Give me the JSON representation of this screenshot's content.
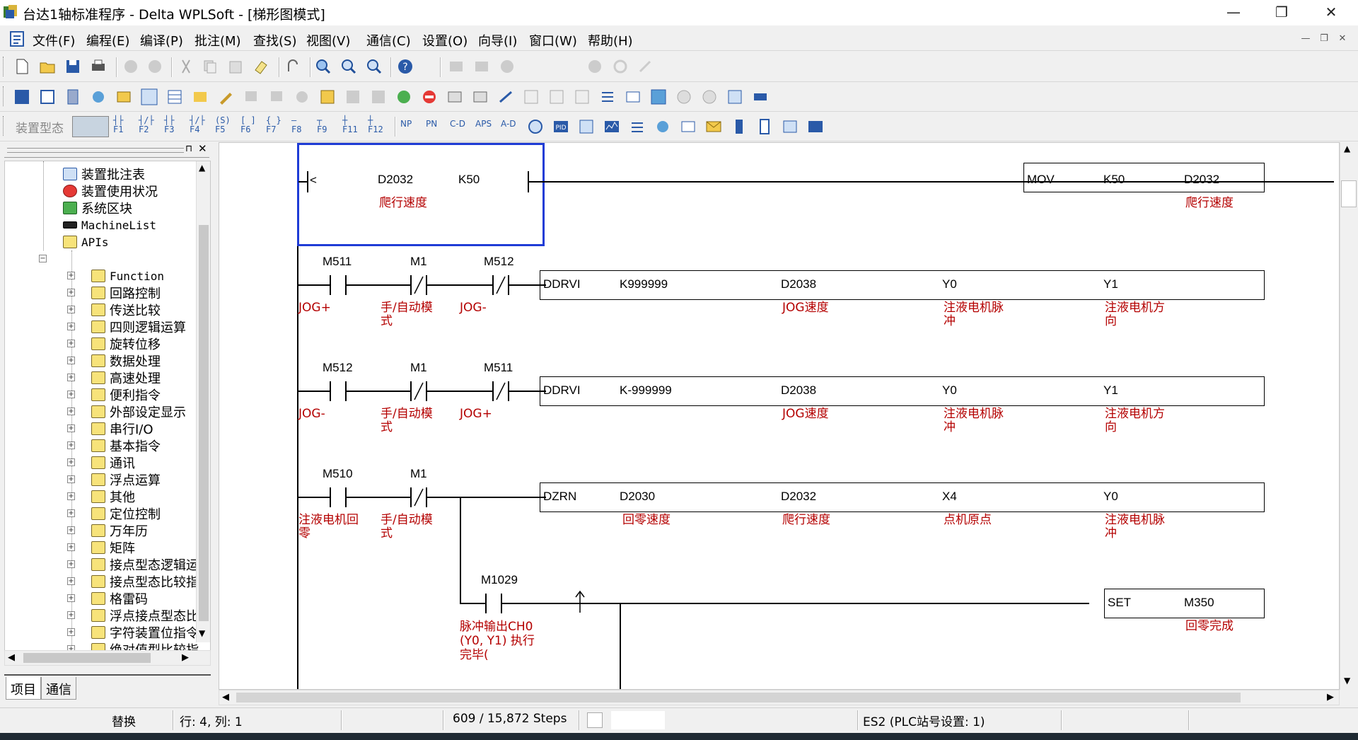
{
  "window": {
    "title": "台达1轴标准程序 - Delta WPLSoft - [梯形图模式]",
    "minimize": "—",
    "restore": "❐",
    "close": "✕"
  },
  "menu": [
    {
      "label": "文件(F)"
    },
    {
      "label": "编程(E)"
    },
    {
      "label": "编译(P)"
    },
    {
      "label": "批注(M)"
    },
    {
      "label": "查找(S)"
    },
    {
      "label": "视图(V)"
    },
    {
      "label": "通信(C)"
    },
    {
      "label": "设置(O)"
    },
    {
      "label": "向导(I)"
    },
    {
      "label": "窗口(W)"
    },
    {
      "label": "帮助(H)"
    }
  ],
  "toolbar1": {
    "step_value": "1"
  },
  "toolbar3": {
    "device_type_label": "装置型态",
    "fkeys": [
      "F1",
      "F2",
      "F3",
      "F4",
      "F5",
      "F6",
      "F7",
      "F8",
      "F9",
      "F11",
      "F12"
    ]
  },
  "project_tree": {
    "items": [
      {
        "label": "装置批注表",
        "indent": 1
      },
      {
        "label": "装置使用状况",
        "indent": 1
      },
      {
        "label": "系统区块",
        "indent": 1
      },
      {
        "label": "MachineList",
        "indent": 1
      },
      {
        "label": "APIs",
        "indent": 0,
        "expanded": true
      },
      {
        "label": "Function",
        "indent": 2
      },
      {
        "label": "回路控制",
        "indent": 2
      },
      {
        "label": "传送比较",
        "indent": 2
      },
      {
        "label": "四则逻辑运算",
        "indent": 2
      },
      {
        "label": "旋转位移",
        "indent": 2
      },
      {
        "label": "数据处理",
        "indent": 2
      },
      {
        "label": "高速处理",
        "indent": 2
      },
      {
        "label": "便利指令",
        "indent": 2
      },
      {
        "label": "外部设定显示",
        "indent": 2
      },
      {
        "label": "串行I/O",
        "indent": 2
      },
      {
        "label": "基本指令",
        "indent": 2
      },
      {
        "label": "通讯",
        "indent": 2
      },
      {
        "label": "浮点运算",
        "indent": 2
      },
      {
        "label": "其他",
        "indent": 2
      },
      {
        "label": "定位控制",
        "indent": 2
      },
      {
        "label": "万年历",
        "indent": 2
      },
      {
        "label": "矩阵",
        "indent": 2
      },
      {
        "label": "接点型态逻辑运",
        "indent": 2
      },
      {
        "label": "接点型态比较指",
        "indent": 2
      },
      {
        "label": "格雷码",
        "indent": 2
      },
      {
        "label": "浮点接点型态比",
        "indent": 2
      },
      {
        "label": "字符装置位指令",
        "indent": 2
      },
      {
        "label": "绝对值型比较指",
        "indent": 2
      }
    ],
    "tabs": [
      "项目",
      "通信"
    ]
  },
  "ladder": {
    "rung1": {
      "cmp_op1": "D2032",
      "cmp_op2": "K50",
      "cmp_comment": "爬行速度",
      "instr": "MOV",
      "src": "K50",
      "dst": "D2032",
      "dst_comment": "爬行速度"
    },
    "rung2": {
      "c1": "M511",
      "c1_cmt": "JOG+",
      "c2": "M1",
      "c2_cmt": "手/自动模式",
      "c3": "M512",
      "c3_cmt": "JOG-",
      "instr": "DDRVI",
      "p1": "K999999",
      "p2": "D2038",
      "p2_cmt": "JOG速度",
      "p3": "Y0",
      "p3_cmt": "注液电机脉冲",
      "p4": "Y1",
      "p4_cmt": "注液电机方向"
    },
    "rung3": {
      "c1": "M512",
      "c1_cmt": "JOG-",
      "c2": "M1",
      "c2_cmt": "手/自动模式",
      "c3": "M511",
      "c3_cmt": "JOG+",
      "instr": "DDRVI",
      "p1": "K-999999",
      "p2": "D2038",
      "p2_cmt": "JOG速度",
      "p3": "Y0",
      "p3_cmt": "注液电机脉冲",
      "p4": "Y1",
      "p4_cmt": "注液电机方向"
    },
    "rung4": {
      "c1": "M510",
      "c1_cmt": "注液电机回零",
      "c2": "M1",
      "c2_cmt": "手/自动模式",
      "instr": "DZRN",
      "p1": "D2030",
      "p1_cmt": "回零速度",
      "p2": "D2032",
      "p2_cmt": "爬行速度",
      "p3": "X4",
      "p3_cmt": "点机原点",
      "p4": "Y0",
      "p4_cmt": "注液电机脉冲",
      "c4": "M1029",
      "c4_cmt": "脉冲输出CH0 (Y0, Y1) 执行完毕(",
      "instr2": "SET",
      "out": "M350",
      "out_cmt": "回零完成"
    }
  },
  "status": {
    "mode": "替换",
    "position": "行: 4, 列: 1",
    "steps": "609 / 15,872 Steps",
    "plc": "ES2 (PLC站号设置: 1)"
  }
}
